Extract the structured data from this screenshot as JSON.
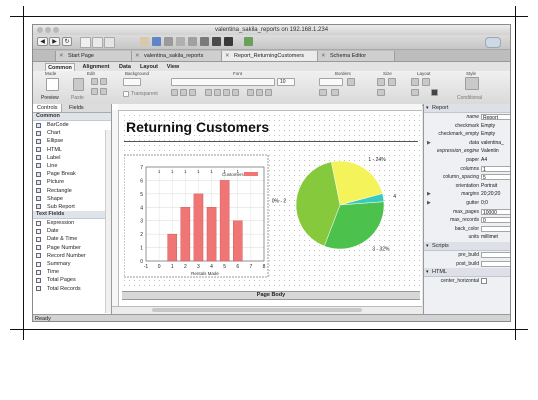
{
  "window": {
    "title": "valentina_sakila_reports on 192.168.1.234"
  },
  "doc_tabs": [
    {
      "label": "Start Page"
    },
    {
      "label": "valentina_sakila_reports"
    },
    {
      "label": "Report_ReturningCustomers"
    },
    {
      "label": "Schema Editor"
    }
  ],
  "ribbon": {
    "tabs": [
      "Common",
      "Alignment",
      "Data",
      "Layout",
      "View"
    ],
    "groups": [
      "Mode",
      "Edit",
      "Background",
      "Font",
      "Borders",
      "Size",
      "Layout",
      "Style"
    ],
    "preview_label": "Preview",
    "paste_label": "Paste",
    "transparent_label": "Transparent",
    "font_size": "10",
    "conditional_label": "Conditional"
  },
  "left_panel": {
    "tabs": [
      "Controls",
      "Fields"
    ],
    "common_header": "Common",
    "common_items": [
      "BarCode",
      "Chart",
      "Ellipse",
      "HTML",
      "Label",
      "Line",
      "Page Break",
      "Picture",
      "Rectangle",
      "Shape",
      "Sub Report"
    ],
    "text_header": "Text Fields",
    "text_items": [
      "Expression",
      "Date",
      "Date & Time",
      "Page Number",
      "Record Number",
      "Summary",
      "Time",
      "Total Pages",
      "Total Records"
    ]
  },
  "report": {
    "title": "Returning Customers",
    "page_body_label": "Page Body"
  },
  "chart_data": [
    {
      "type": "bar",
      "legend": "Customers",
      "xlabel": "Rentals Made",
      "ylabel": "",
      "title": "",
      "x": [
        1,
        2,
        3,
        4,
        5,
        6
      ],
      "values": [
        2,
        4,
        5,
        4,
        6,
        3
      ],
      "xlim": [
        -1,
        8
      ],
      "ylim": [
        0,
        7
      ],
      "x_ticks": [
        "-1",
        "0",
        "1",
        "2",
        "3",
        "4",
        "5",
        "6",
        "7",
        "8"
      ],
      "y_ticks": [
        "0",
        "1",
        "2",
        "3",
        "4",
        "5",
        "6",
        "7"
      ],
      "top_ticks": [
        "1",
        "1",
        "1",
        "1",
        "1",
        "1",
        "1"
      ],
      "grid": true,
      "color": "#f07575"
    },
    {
      "type": "pie",
      "slices": [
        {
          "label": "1 - 24%",
          "value": 24,
          "color": "#f4f45a"
        },
        {
          "label": "4",
          "value": 3,
          "color": "#3cc9bd"
        },
        {
          "label": "3 - 32%",
          "value": 32,
          "color": "#4cc24c"
        },
        {
          "label": "40% - 2",
          "value": 41,
          "color": "#86c93c"
        }
      ]
    }
  ],
  "properties": {
    "report_header": "Report",
    "rows": [
      {
        "name": "name",
        "value": "Report_",
        "kind": "box",
        "italic": true
      },
      {
        "name": "checkmark",
        "value": "Empty",
        "kind": "text"
      },
      {
        "name": "checkmark_empty",
        "value": "Empty",
        "kind": "text"
      },
      {
        "name": "data",
        "value": "valentina_",
        "kind": "text",
        "arrow": true,
        "italic": true
      },
      {
        "name": "expression_engine",
        "value": "Valentin",
        "kind": "text",
        "italic": true
      },
      {
        "name": "paper",
        "value": "A4",
        "kind": "text"
      },
      {
        "name": "columns",
        "value": "1",
        "kind": "box"
      },
      {
        "name": "column_spacing",
        "value": "5",
        "kind": "box"
      },
      {
        "name": "orientation",
        "value": "Portrait",
        "kind": "text"
      },
      {
        "name": "margins",
        "value": "20;20;20",
        "kind": "text",
        "arrow": true,
        "italic": true
      },
      {
        "name": "gutter",
        "value": "0;0",
        "kind": "text",
        "arrow": true
      },
      {
        "name": "max_pages",
        "value": "10000",
        "kind": "box"
      },
      {
        "name": "max_records",
        "value": "0",
        "kind": "box"
      },
      {
        "name": "back_color",
        "value": "",
        "kind": "box"
      },
      {
        "name": "units",
        "value": "millimet",
        "kind": "text"
      }
    ],
    "scripts_header": "Scripts",
    "script_rows": [
      {
        "name": "pre_build",
        "value": ""
      },
      {
        "name": "post_build",
        "value": ""
      }
    ],
    "html_header": "HTML",
    "html_rows": [
      {
        "name": "center_horizontal",
        "value": ""
      }
    ]
  },
  "status": {
    "text": "Ready"
  },
  "colors": {
    "accent_blue": "#3a6fd8"
  }
}
